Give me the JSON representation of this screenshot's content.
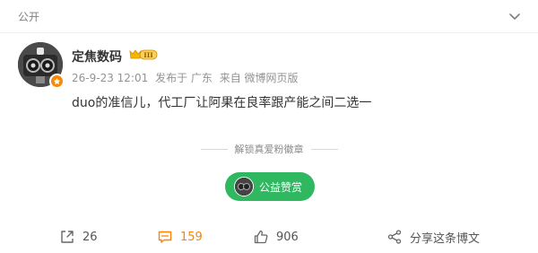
{
  "post": {
    "visibility": "公开",
    "author": "定焦数码",
    "vip_badge": "III",
    "meta": {
      "time": "26-9-23 12:01",
      "location": "发布于 广东",
      "source": "来自 微博网页版"
    },
    "content": "duo的准信儿，代工厂让阿果在良率跟产能之间二选一",
    "unlock_text": "解锁真爱粉徽章",
    "reward_label": "公益赞赏",
    "actions": {
      "forward_count": "26",
      "comment_count": "159",
      "like_count": "906",
      "share_label": "分享这条博文"
    }
  },
  "colors": {
    "accent_orange": "#ff8200",
    "reward_green": "#2fb860",
    "meta_gray": "#939393"
  },
  "icons": [
    "chevron-down-icon",
    "avatar-badge-icon",
    "vip-crown-icon",
    "forward-icon",
    "comment-icon",
    "like-icon",
    "share-icon"
  ]
}
